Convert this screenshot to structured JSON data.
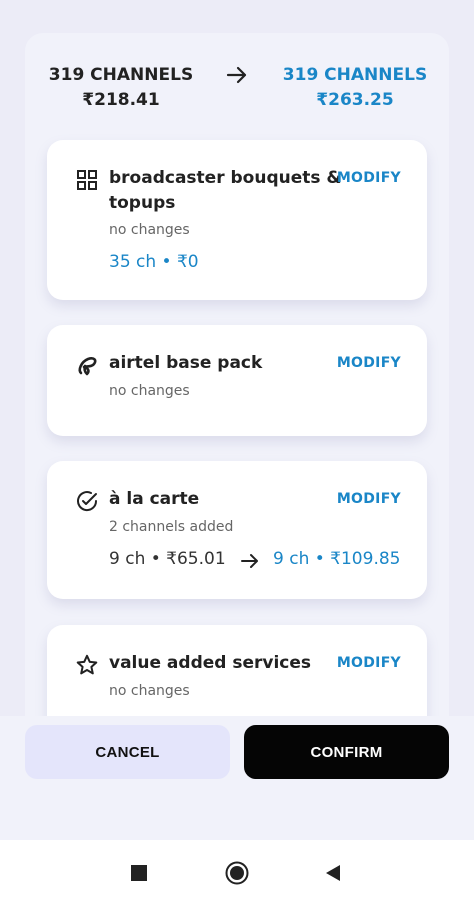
{
  "summary": {
    "current_channels": "319 CHANNELS",
    "current_price": "₹218.41",
    "new_channels": "319 CHANNELS",
    "new_price": "₹263.25"
  },
  "cards": [
    {
      "title_line1": "broadcaster bouquets &",
      "title_line2": "topups",
      "modify": "MODIFY",
      "status": "no changes",
      "price": "35 ch • ₹0",
      "icon": "grid-icon"
    },
    {
      "title": "airtel base pack",
      "modify": "MODIFY",
      "status": "no changes",
      "icon": "airtel-logo-icon"
    },
    {
      "title": "à la carte",
      "modify": "MODIFY",
      "status": "2 channels added",
      "old_price": "9 ch • ₹65.01",
      "new_price": "9 ch • ₹109.85",
      "icon": "check-circle-icon"
    },
    {
      "title": "value added services",
      "modify": "MODIFY",
      "status": "no changes",
      "icon": "star-icon"
    }
  ],
  "actions": {
    "cancel": "CANCEL",
    "confirm": "CONFIRM"
  },
  "colors": {
    "accent": "#1a86c7",
    "confirm_bg": "#050505",
    "cancel_bg": "#e4e5fb"
  }
}
